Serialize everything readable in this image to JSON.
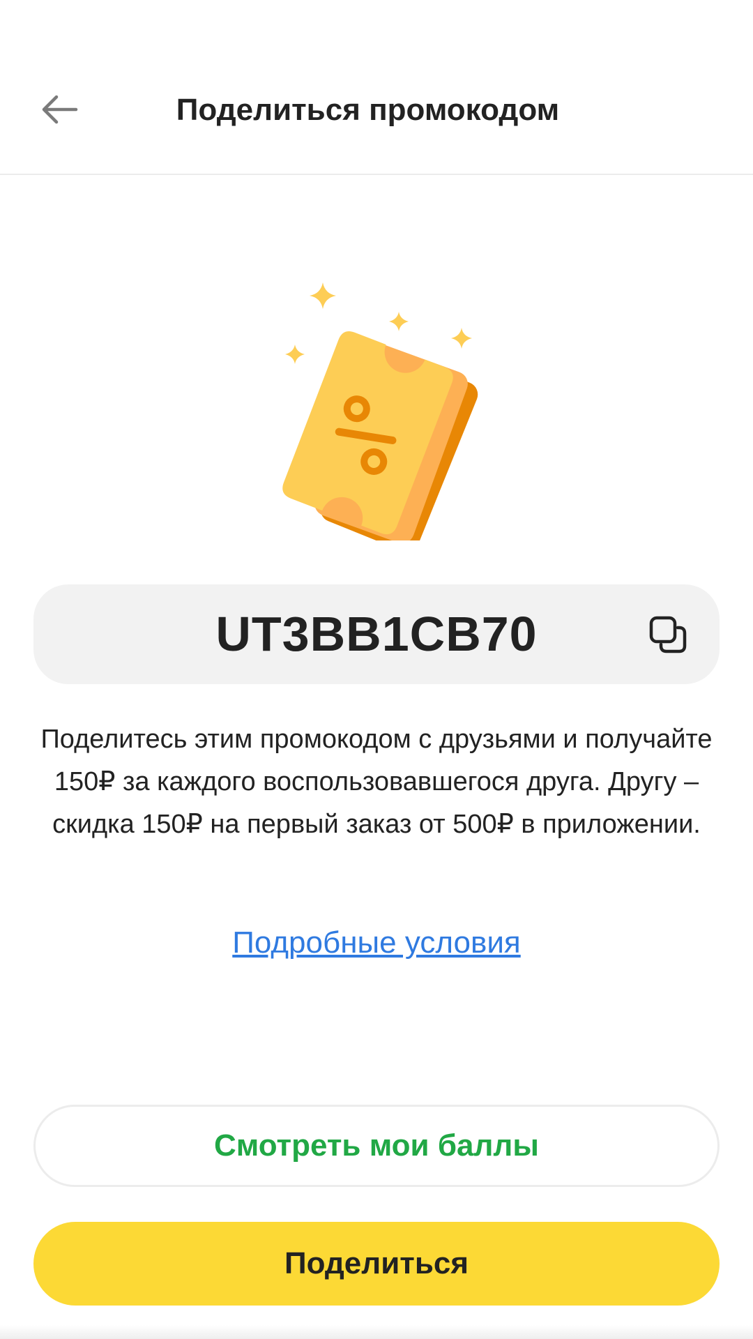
{
  "header": {
    "title": "Поделиться промокодом",
    "back_icon": "arrow-left-icon"
  },
  "illustration": {
    "icon": "discount-coupon-icon",
    "colors": {
      "ticket": "#FDCD55",
      "back_ticket_1": "#FDB054",
      "back_ticket_2": "#E88705",
      "percent": "#E88705",
      "sparkle": "#FDCD55"
    }
  },
  "promo": {
    "code": "UT3BB1CB70",
    "copy_icon": "copy-icon"
  },
  "description": "Поделитесь этим промокодом с друзьями и получайте 150₽ за каждого воспользовавшегося друга. Другу – скидка 150₽ на первый заказ от 500₽ в приложении.",
  "terms_link": "Подробные условия",
  "buttons": {
    "view_points": "Смотреть мои баллы",
    "share": "Поделиться"
  },
  "colors": {
    "primary_yellow": "#FCD935",
    "accent_green": "#21A845",
    "link_blue": "#2F7AE0",
    "code_bg": "#F2F2F2"
  }
}
